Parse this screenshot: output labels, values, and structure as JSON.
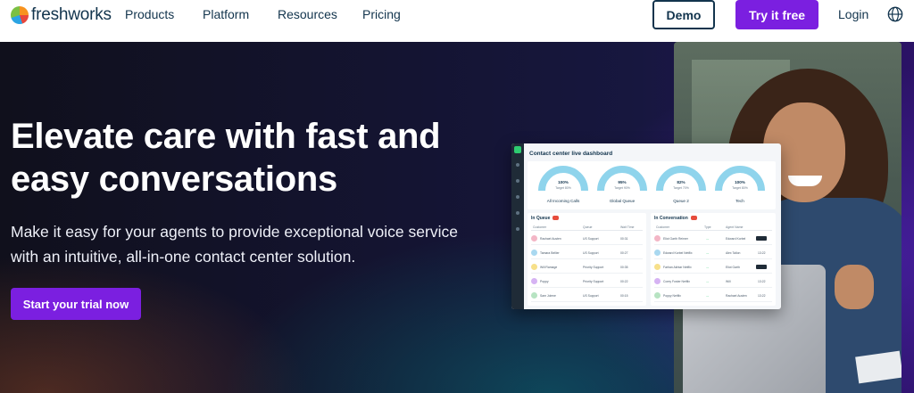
{
  "nav": {
    "logo_text": "freshworks",
    "links": [
      "Products",
      "Platform",
      "Resources",
      "Pricing"
    ],
    "demo_label": "Demo",
    "try_label": "Try it free",
    "login_label": "Login"
  },
  "hero": {
    "headline": "Elevate care with fast and easy conversations",
    "subtext": "Make it easy for your agents to provide exceptional voice service with an intuitive, all-in-one contact center solution.",
    "cta_label": "Start your trial now"
  },
  "dashboard": {
    "title": "Contact center live dashboard",
    "gauges": [
      {
        "percent": "100%",
        "sub": "Target 80%",
        "label": "All Incoming Calls"
      },
      {
        "percent": "95%",
        "sub": "Target 90%",
        "label": "Global Queue"
      },
      {
        "percent": "82%",
        "sub": "Target 70%",
        "label": "Queue 2"
      },
      {
        "percent": "100%",
        "sub": "Target 80%",
        "label": "Tech"
      }
    ],
    "in_queue": {
      "title": "In Queue",
      "headers": [
        "Customer",
        "Queue",
        "Wait Time"
      ],
      "rows": [
        {
          "name": "Rachael Austen",
          "queue": "US Support",
          "wait": "00:31"
        },
        {
          "name": "Tamara Bellier",
          "queue": "US Support",
          "wait": "00:27"
        },
        {
          "name": "Will Ramage",
          "queue": "Priority Support",
          "wait": "00:35"
        },
        {
          "name": "Poppy",
          "queue": "Priority Support",
          "wait": "00:22"
        },
        {
          "name": "Sam Jolene",
          "queue": "US Support",
          "wait": "00:15"
        }
      ]
    },
    "in_conversation": {
      "title": "In Conversation",
      "headers": [
        "Customer",
        "Type",
        "Agent Name"
      ],
      "rows": [
        {
          "name": "Eliot Garth Reimer",
          "agent": "Edward Korbel",
          "time": ""
        },
        {
          "name": "Edward Korbel Netflix",
          "agent": "Alex Tallon",
          "time": "13:22"
        },
        {
          "name": "Farhan Akhtar Netflix",
          "agent": "Eliot Garth",
          "time": ""
        },
        {
          "name": "Corey Foster Netflix",
          "agent": "Will",
          "time": "13:22"
        },
        {
          "name": "Poppy Netflix",
          "agent": "Rachael Austen",
          "time": "13:22"
        }
      ]
    }
  },
  "colors": {
    "brand_purple": "#7b1fe0",
    "navy": "#12344d",
    "gauge": "#8fd4ec"
  }
}
